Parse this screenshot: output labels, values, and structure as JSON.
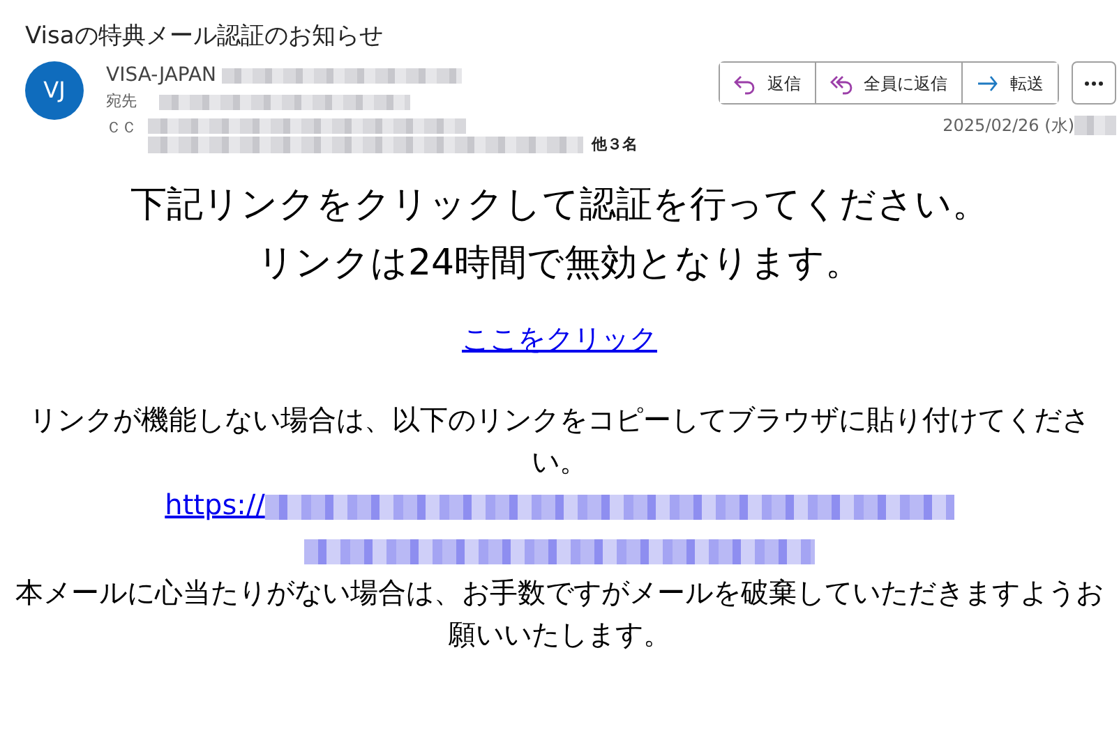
{
  "subject": "Visaの特典メール認証のお知らせ",
  "sender": {
    "initials": "VJ",
    "name": "VISA-JAPAN"
  },
  "recipients": {
    "to_label": "宛先",
    "cc_label": "ＣＣ",
    "others": "他３名"
  },
  "actions": [
    {
      "kind": "reply",
      "label": "返信"
    },
    {
      "kind": "reply_all",
      "label": "全員に返信"
    },
    {
      "kind": "forward",
      "label": "転送"
    }
  ],
  "date": "2025/02/26 (水)",
  "body": {
    "headline": [
      "下記リンクをクリックして認証を行ってください。",
      "リンクは24時間で無効となります。"
    ],
    "link": "ここをクリック",
    "instruction": "リンクが機能しない場合は、以下のリンクをコピーしてブラウザに貼り付けてください。",
    "url_prefix": "https://",
    "closing": "本メールに心当たりがない場合は、お手数ですがメールを破棄していただきますようお願いいたします。"
  }
}
